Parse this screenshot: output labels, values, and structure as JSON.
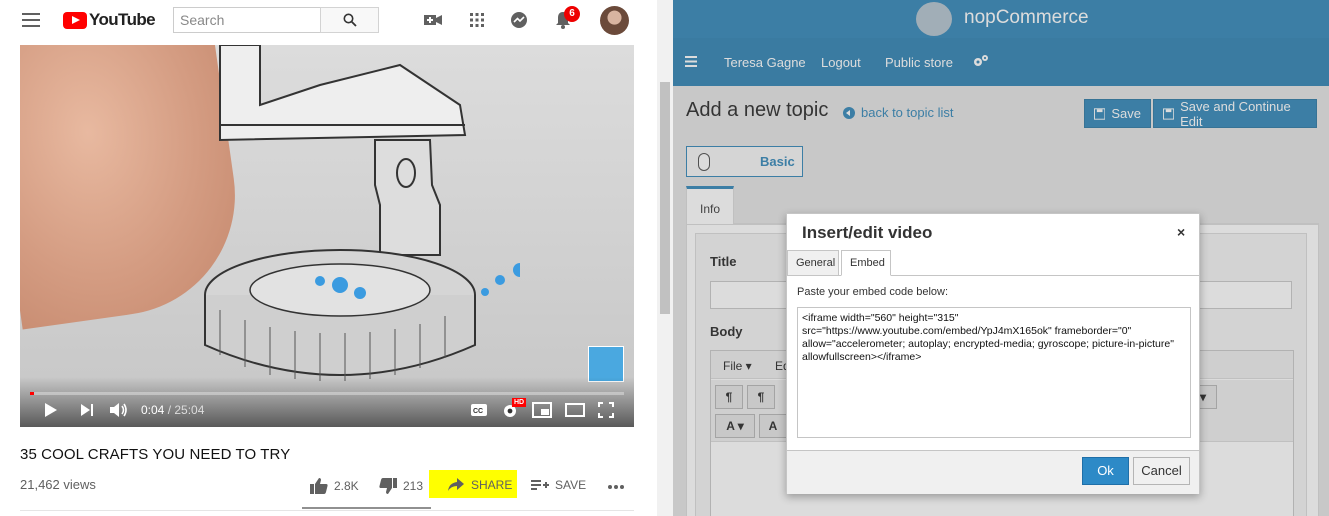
{
  "youtube": {
    "logo_text": "YouTube",
    "search_placeholder": "Search",
    "notification_count": "6",
    "player": {
      "current_time": "0:04",
      "duration": " / 25:04",
      "progress_fraction": 0.0027,
      "hd_badge": "HD"
    },
    "video_title": "35 COOL CRAFTS YOU NEED TO TRY",
    "views": "21,462 views",
    "actions": {
      "likes": "2.8K",
      "dislikes": "213",
      "share": "SHARE",
      "save": "SAVE"
    },
    "colors": {
      "brand": "#ff0000",
      "share_highlight": "#ffff00"
    }
  },
  "nop": {
    "logo_text": "nopCommerce",
    "nav": {
      "user": "Teresa Gagne",
      "logout": "Logout",
      "public_store": "Public store"
    },
    "page_title": "Add a new topic",
    "back_link": "back to topic list",
    "buttons": {
      "save": "Save",
      "save_continue": "Save and Continue Edit"
    },
    "mode_toggle": "Basic",
    "tabs": {
      "info": "Info"
    },
    "fields": {
      "title_label": "Title",
      "body_label": "Body"
    },
    "editor_menu": {
      "file": "File ▾",
      "edit": "Ed"
    },
    "colors": {
      "accent": "#3c8dbc"
    }
  },
  "dialog": {
    "title": "Insert/edit video",
    "close": "×",
    "tabs": {
      "general": "General",
      "embed": "Embed"
    },
    "prompt": "Paste your embed code below:",
    "embed_code": "<iframe width=\"560\" height=\"315\"\nsrc=\"https://www.youtube.com/embed/YpJ4mX165ok\" frameborder=\"0\"\nallow=\"accelerometer; autoplay; encrypted-media; gyroscope; picture-in-picture\"\nallowfullscreen></iframe>",
    "ok": "Ok",
    "cancel": "Cancel"
  }
}
